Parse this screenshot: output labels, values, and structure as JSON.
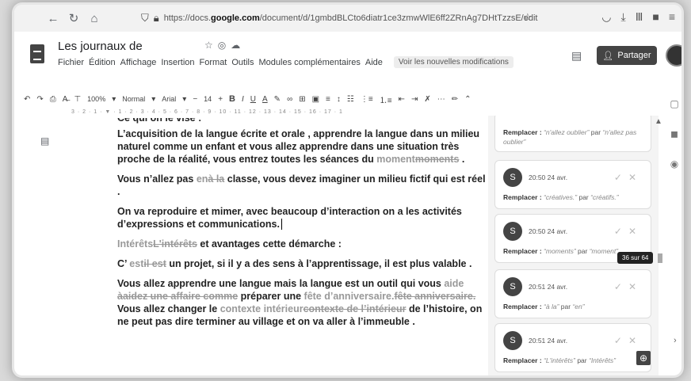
{
  "browser": {
    "url_prefix": "https://docs.",
    "url_domain": "google.com",
    "url_suffix": "/document/d/1gmbdBLCto6diatr1ce3zmwWlE6ff2ZRnAg7DHtTzzsE/edit"
  },
  "doc": {
    "title": "Les journaux de",
    "menu": [
      "Fichier",
      "Édition",
      "Affichage",
      "Insertion",
      "Format",
      "Outils",
      "Modules complémentaires",
      "Aide"
    ],
    "news_link": "Voir les nouvelles modifications",
    "share_label": "Partager"
  },
  "toolbar": {
    "zoom": "100%",
    "style": "Normal",
    "font": "Arial",
    "size": "14",
    "ruler": "3 · 2 · 1 · ▼ · 1 · 2 · 3 · 4 · 5 · 6 · 7 · 8 · 9 · 10 · 11 · 12 · 13 · 14 · 15 · 16 · 17 · 1"
  },
  "body": {
    "p0": "Ce qui on le vise :",
    "p1": "L’acquisition de la langue écrite et orale , apprendre la langue dans un milieu naturel comme un enfant et vous allez apprendre dans une situation très proche  de la réalité, vous entrez toutes les séances du ",
    "p1_g": "moment",
    "p1_s": "moments",
    "p1_end": " .",
    "p2_a": "Vous n’allez pas ",
    "p2_g": "en",
    "p2_s": "à la",
    "p2_b": " classe, vous devez imaginer un milieu fictif qui est réel .",
    "p3": "On va reproduire et mimer, avec beaucoup d’interaction on a les activités d’expressions et communications.",
    "p4_g": "Intérêts",
    "p4_s": "L'intérêts",
    "p4_b": " et avantages cette démarche :",
    "p5_a": "C’ ",
    "p5_g": "est",
    "p5_s": "il est",
    "p5_b": " un projet, si il y a des sens à l’apprentissage, il est plus valable .",
    "p6_a": "Vous allez apprendre une langue mais la langue est un outil qui vous ",
    "p6_g1": "aide ",
    "p6_s1": "àaidez une affaire comme",
    "p6_b": " préparer une ",
    "p6_g2": "fête d’anniversaire.",
    "p6_s2": "fête anniversaire.",
    "p6_c": " Vous allez changer le ",
    "p6_g3": "contexte intérieur",
    "p6_s3": "contexte de l’intérieur",
    "p6_d": " de l’histoire, on ne peut pas dire terminer au village et on va aller à l’immeuble ."
  },
  "comments": [
    {
      "time": "",
      "label": "Remplacer :",
      "from": "“n'allez oublier”",
      "to": "“n'allez pas oublier”"
    },
    {
      "time": "20:50 24 avr.",
      "label": "Remplacer :",
      "from": "“créatives.”",
      "to": "“créatifs.”"
    },
    {
      "time": "20:50 24 avr.",
      "label": "Remplacer :",
      "from": "“moments”",
      "to": "“moment”"
    },
    {
      "time": "20:51 24 avr.",
      "label": "Remplacer :",
      "from": "“à la”",
      "to": "“en”"
    },
    {
      "time": "20:51 24 avr.",
      "label": "Remplacer :",
      "from": "“L'intérêts”",
      "to": "“Intérêts”"
    }
  ],
  "avatar_letter": "S",
  "par_word": "par",
  "counter": "36 sur 64"
}
